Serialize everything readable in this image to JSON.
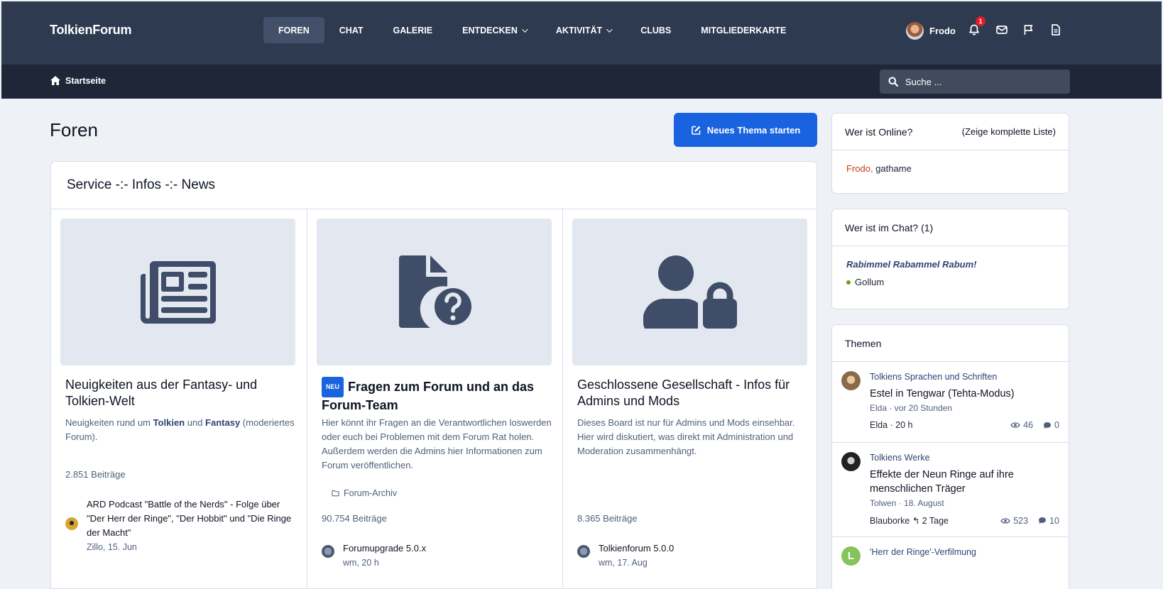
{
  "header": {
    "brand": "TolkienForum",
    "nav": [
      {
        "label": "FOREN",
        "active": true,
        "dropdown": false
      },
      {
        "label": "CHAT",
        "active": false,
        "dropdown": false
      },
      {
        "label": "GALERIE",
        "active": false,
        "dropdown": false
      },
      {
        "label": "ENTDECKEN",
        "active": false,
        "dropdown": true
      },
      {
        "label": "AKTIVITÄT",
        "active": false,
        "dropdown": true
      },
      {
        "label": "CLUBS",
        "active": false,
        "dropdown": false
      },
      {
        "label": "MITGLIEDERKARTE",
        "active": false,
        "dropdown": false
      }
    ],
    "user_name": "Frodo",
    "notification_count": "1",
    "icons": [
      "bell-icon",
      "envelope-icon",
      "flag-icon",
      "document-icon"
    ]
  },
  "subbar": {
    "breadcrumb": "Startseite",
    "search_placeholder": "Suche ..."
  },
  "page": {
    "title": "Foren",
    "new_thread_label": "Neues Thema starten"
  },
  "category": {
    "title": "Service -:- Infos -:- News",
    "forums": [
      {
        "icon": "newspaper-icon",
        "title": "Neuigkeiten aus der Fantasy- und Tolkien-Welt",
        "desc_prefix": "Neuigkeiten rund um ",
        "desc_b1": "Tolkien",
        "desc_mid": " und ",
        "desc_b2": "Fantasy",
        "desc_suffix": " (moderiertes Forum).",
        "count": "2.851 Beiträge",
        "latest_title": "ARD Podcast \"Battle of the Nerds\" - Folge über \"Der Herr der Ringe\", \"Der Hobbit\" und \"Die Ringe der Macht\"",
        "latest_meta": "Zillo, 15. Jun"
      },
      {
        "icon": "file-question-icon",
        "badge": "NEU",
        "title": "Fragen zum Forum und an das Forum-Team",
        "desc": "Hier könnt ihr Fragen an die Verantwortlichen loswerden oder euch bei Problemen mit dem Forum Rat holen. Außerdem werden die Admins hier Informationen zum Forum veröffentlichen.",
        "subforum": "Forum-Archiv",
        "count": "90.754 Beiträge",
        "latest_title": "Forumupgrade 5.0.x",
        "latest_meta": "wm, 20 h"
      },
      {
        "icon": "user-lock-icon",
        "title": "Geschlossene Gesellschaft - Infos für Admins und Mods",
        "desc": "Dieses Board ist nur für Admins und Mods einsehbar. Hier wird diskutiert, was direkt mit Administration und Moderation zusammenhängt.",
        "count": "8.365 Beiträge",
        "latest_title": "Tolkienforum 5.0.0",
        "latest_meta": "wm, 17. Aug"
      }
    ]
  },
  "sidebar": {
    "online": {
      "title": "Wer ist Online?",
      "link": "(Zeige komplette Liste)",
      "user1": "Frodo,",
      "user2": "gathame"
    },
    "chat": {
      "title": "Wer ist im Chat? (1)",
      "message": "Rabimmel Rabammel Rabum!",
      "user": "Gollum"
    },
    "topics": {
      "title": "Themen",
      "items": [
        {
          "forum": "Tolkiens Sprachen und Schriften",
          "title": "Estel in Tengwar (Tehta-Modus)",
          "meta": "Elda · vor 20 Stunden",
          "last": "Elda · 20 h",
          "views": "46",
          "replies": "0"
        },
        {
          "forum": "Tolkiens Werke",
          "title": "Effekte der Neun Ringe auf ihre menschlichen Träger",
          "meta": "Tolwen · 18. August",
          "last": "Blauborke ↰ 2 Tage",
          "views": "523",
          "replies": "10"
        },
        {
          "forum": "'Herr der Ringe'-Verfilmung",
          "avatar_letter": "L"
        }
      ]
    }
  },
  "colors": {
    "header_bg": "#2d3a50",
    "subbar_bg": "#1e2638",
    "accent": "#1a63e0",
    "page_bg": "#eef1f6",
    "online_user": "#c2410c",
    "notification": "#e11d28"
  }
}
